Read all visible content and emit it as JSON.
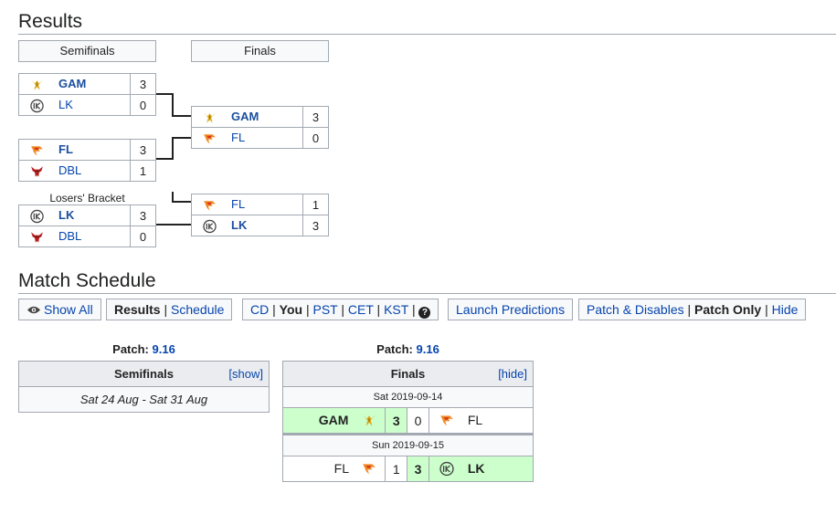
{
  "results": {
    "title": "Results"
  },
  "bracket": {
    "phase_semis": "Semifinals",
    "phase_finals": "Finals",
    "losers_label": "Losers' Bracket",
    "semi1": [
      {
        "team": "GAM",
        "score": "3",
        "win": true,
        "icon": "gam-logo-icon"
      },
      {
        "team": "LK",
        "score": "0",
        "win": false,
        "icon": "lk-logo-icon"
      }
    ],
    "semi2": [
      {
        "team": "FL",
        "score": "3",
        "win": true,
        "icon": "fl-logo-icon"
      },
      {
        "team": "DBL",
        "score": "1",
        "win": false,
        "icon": "dbl-logo-icon"
      }
    ],
    "final1": [
      {
        "team": "GAM",
        "score": "3",
        "win": true,
        "icon": "gam-logo-icon"
      },
      {
        "team": "FL",
        "score": "0",
        "win": false,
        "icon": "fl-logo-icon"
      }
    ],
    "losers": [
      {
        "team": "LK",
        "score": "3",
        "win": true,
        "icon": "lk-logo-icon"
      },
      {
        "team": "DBL",
        "score": "0",
        "win": false,
        "icon": "dbl-logo-icon"
      }
    ],
    "final2": [
      {
        "team": "FL",
        "score": "1",
        "win": false,
        "icon": "fl-logo-icon"
      },
      {
        "team": "LK",
        "score": "3",
        "win": true,
        "icon": "lk-logo-icon"
      }
    ]
  },
  "schedule": {
    "title": "Match Schedule",
    "toolbar": {
      "show_all": "Show All",
      "results": "Results",
      "schedule": "Schedule",
      "tz_cd": "CD",
      "tz_you": "You",
      "tz_pst": "PST",
      "tz_cet": "CET",
      "tz_kst": "KST",
      "launch_predictions": "Launch Predictions",
      "patch_disables": "Patch & Disables",
      "patch_only": "Patch Only",
      "hide": "Hide",
      "sep": "|"
    },
    "semis": {
      "patch_label": "Patch:",
      "patch_value": "9.16",
      "title": "Semifinals",
      "toggle": "[show]",
      "range": "Sat 24 Aug - Sat 31 Aug"
    },
    "finals": {
      "patch_label": "Patch:",
      "patch_value": "9.16",
      "title": "Finals",
      "toggle": "[hide]",
      "day1": "Sat 2019-09-14",
      "match1": {
        "team1": "GAM",
        "s1": "3",
        "s2": "0",
        "team2": "FL"
      },
      "day2": "Sun 2019-09-15",
      "match2": {
        "team1": "FL",
        "s1": "1",
        "s2": "3",
        "team2": "LK"
      }
    }
  },
  "colors": {
    "link": "#0645ad",
    "win_bg": "#ccffcc",
    "border": "#a2a9b1",
    "header_bg": "#eaecf0"
  }
}
